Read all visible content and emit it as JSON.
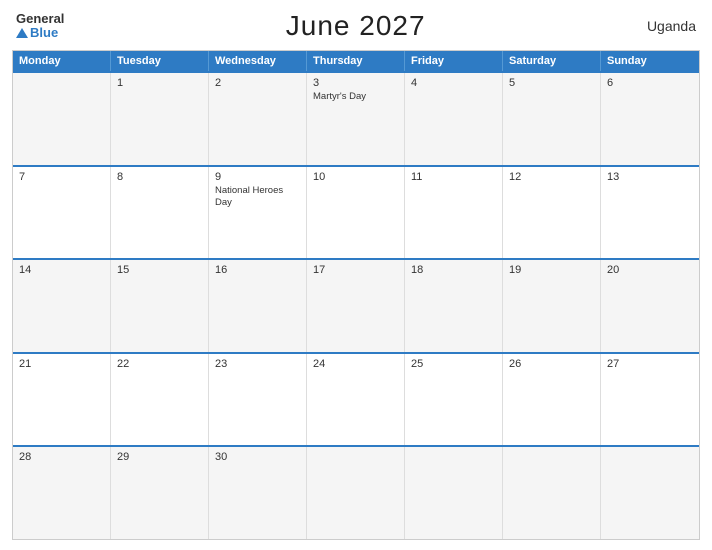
{
  "header": {
    "logo_general": "General",
    "logo_blue": "Blue",
    "title": "June 2027",
    "country": "Uganda"
  },
  "calendar": {
    "days_of_week": [
      "Monday",
      "Tuesday",
      "Wednesday",
      "Thursday",
      "Friday",
      "Saturday",
      "Sunday"
    ],
    "weeks": [
      [
        {
          "day": "",
          "event": ""
        },
        {
          "day": "1",
          "event": ""
        },
        {
          "day": "2",
          "event": ""
        },
        {
          "day": "3",
          "event": "Martyr's Day"
        },
        {
          "day": "4",
          "event": ""
        },
        {
          "day": "5",
          "event": ""
        },
        {
          "day": "6",
          "event": ""
        }
      ],
      [
        {
          "day": "7",
          "event": ""
        },
        {
          "day": "8",
          "event": ""
        },
        {
          "day": "9",
          "event": "National Heroes Day"
        },
        {
          "day": "10",
          "event": ""
        },
        {
          "day": "11",
          "event": ""
        },
        {
          "day": "12",
          "event": ""
        },
        {
          "day": "13",
          "event": ""
        }
      ],
      [
        {
          "day": "14",
          "event": ""
        },
        {
          "day": "15",
          "event": ""
        },
        {
          "day": "16",
          "event": ""
        },
        {
          "day": "17",
          "event": ""
        },
        {
          "day": "18",
          "event": ""
        },
        {
          "day": "19",
          "event": ""
        },
        {
          "day": "20",
          "event": ""
        }
      ],
      [
        {
          "day": "21",
          "event": ""
        },
        {
          "day": "22",
          "event": ""
        },
        {
          "day": "23",
          "event": ""
        },
        {
          "day": "24",
          "event": ""
        },
        {
          "day": "25",
          "event": ""
        },
        {
          "day": "26",
          "event": ""
        },
        {
          "day": "27",
          "event": ""
        }
      ],
      [
        {
          "day": "28",
          "event": ""
        },
        {
          "day": "29",
          "event": ""
        },
        {
          "day": "30",
          "event": ""
        },
        {
          "day": "",
          "event": ""
        },
        {
          "day": "",
          "event": ""
        },
        {
          "day": "",
          "event": ""
        },
        {
          "day": "",
          "event": ""
        }
      ]
    ]
  }
}
